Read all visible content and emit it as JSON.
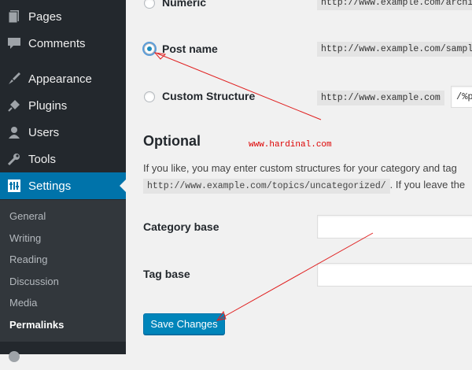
{
  "sidebar": {
    "items": [
      {
        "label": "Pages",
        "icon": "pages-icon"
      },
      {
        "label": "Comments",
        "icon": "comments-icon"
      },
      {
        "label": "Appearance",
        "icon": "appearance-icon"
      },
      {
        "label": "Plugins",
        "icon": "plugins-icon"
      },
      {
        "label": "Users",
        "icon": "users-icon"
      },
      {
        "label": "Tools",
        "icon": "tools-icon"
      },
      {
        "label": "Settings",
        "icon": "settings-icon",
        "active": true
      }
    ],
    "submenu": [
      {
        "label": "General"
      },
      {
        "label": "Writing"
      },
      {
        "label": "Reading"
      },
      {
        "label": "Discussion"
      },
      {
        "label": "Media"
      },
      {
        "label": "Permalinks",
        "current": true
      }
    ],
    "accent": "#0073aa"
  },
  "permalink_options": [
    {
      "label": "Numeric",
      "example": "http://www.example.com/archi",
      "checked": false
    },
    {
      "label": "Post name",
      "example": "http://www.example.com/sampl",
      "checked": true
    },
    {
      "label": "Custom Structure",
      "example": "http://www.example.com",
      "value": "/%p",
      "checked": false
    }
  ],
  "optional": {
    "heading": "Optional",
    "watermark": "www.hardinal.com",
    "description": "If you like, you may enter custom structures for your category and tag",
    "example_code": "http://www.example.com/topics/uncategorized/",
    "description_after": ". If you leave the",
    "category_base_label": "Category base",
    "category_base_value": "",
    "tag_base_label": "Tag base",
    "tag_base_value": ""
  },
  "save_button": "Save Changes",
  "annotation_color": "#e02020"
}
